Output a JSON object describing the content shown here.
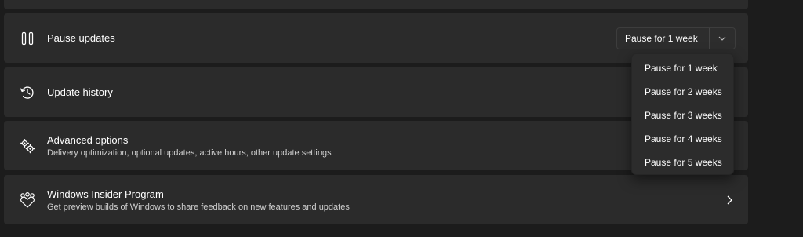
{
  "settings": {
    "pause": {
      "title": "Pause updates",
      "selected": "Pause for 1 week",
      "icon": "pause-icon"
    },
    "history": {
      "title": "Update history",
      "icon": "history-icon"
    },
    "advanced": {
      "title": "Advanced options",
      "subtitle": "Delivery optimization, optional updates, active hours, other update settings",
      "icon": "gears-icon"
    },
    "insider": {
      "title": "Windows Insider Program",
      "subtitle": "Get preview builds of Windows to share feedback on new features and updates",
      "icon": "insider-icon"
    }
  },
  "dropdown": {
    "options": [
      "Pause for 1 week",
      "Pause for 2 weeks",
      "Pause for 3 weeks",
      "Pause for 4 weeks",
      "Pause for 5 weeks"
    ]
  },
  "colors": {
    "background": "#1c1c1c",
    "card": "#2b2b2b",
    "menu": "#2c2c2c",
    "text": "#ffffff",
    "subtext": "#cfcfcf"
  }
}
